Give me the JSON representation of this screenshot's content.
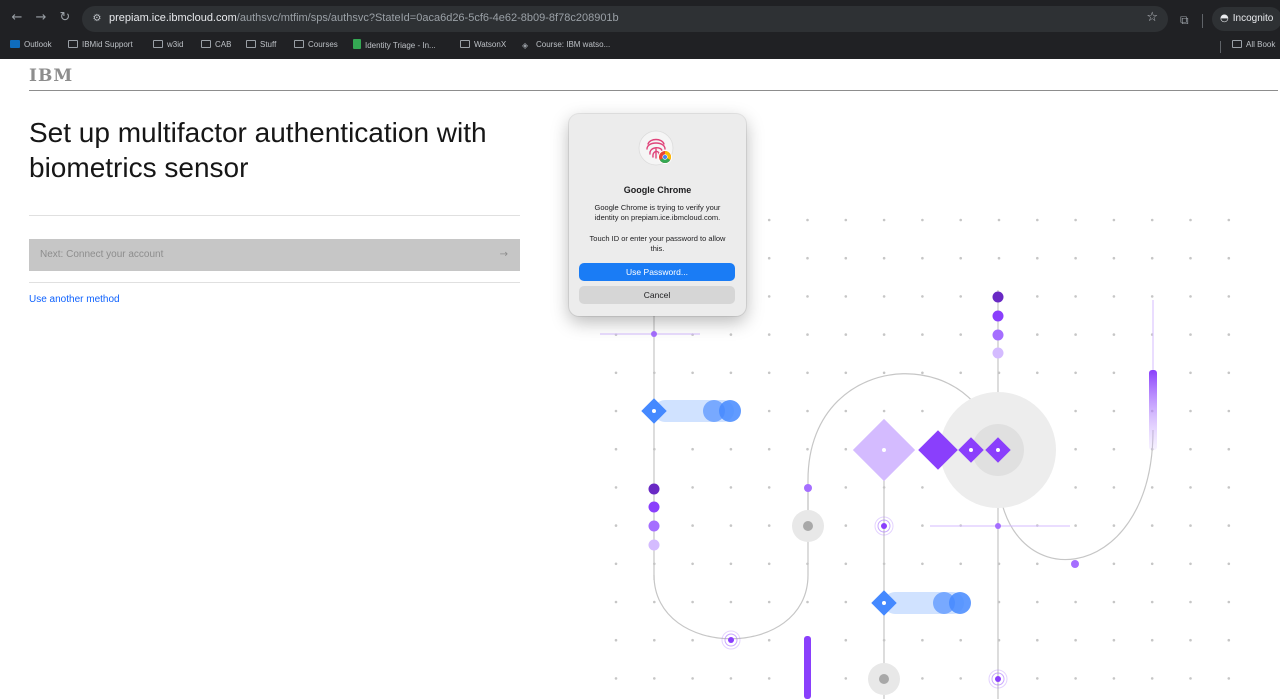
{
  "browser": {
    "url_host": "prepiam.ice.ibmcloud.com",
    "url_path": "/authsvc/mtfim/sps/authsvc?StateId=0aca6d26-5cf6-4e62-8b09-8f78c208901b",
    "incognito_label": "Incognito",
    "bookmarks": [
      {
        "label": "Outlook",
        "icon": "outlook-icon"
      },
      {
        "label": "IBMid Support",
        "icon": "folder-icon"
      },
      {
        "label": "w3id",
        "icon": "folder-icon"
      },
      {
        "label": "CAB",
        "icon": "folder-icon"
      },
      {
        "label": "Stuff",
        "icon": "folder-icon"
      },
      {
        "label": "Courses",
        "icon": "folder-icon"
      },
      {
        "label": "Identity Triage - In...",
        "icon": "sheet-icon"
      },
      {
        "label": "WatsonX",
        "icon": "folder-icon"
      },
      {
        "label": "Course: IBM watso...",
        "icon": "course-icon"
      }
    ],
    "all_bookmarks": "All Book"
  },
  "page": {
    "logo": "IBM",
    "title": "Set up multifactor authentication with biometrics sensor",
    "next_button": "Next: Connect your account",
    "alt_link": "Use another method"
  },
  "dialog": {
    "app_name": "Google Chrome",
    "message": "Google Chrome is trying to verify your identity on prepiam.ice.ibmcloud.com.",
    "instruction": "Touch ID or enter your password to allow this.",
    "primary_button": "Use Password...",
    "cancel_button": "Cancel"
  },
  "colors": {
    "chrome_bg": "#202124",
    "ibm_blue": "#0f62fe",
    "purple": "#8a3ffc",
    "light_purple": "#a56eff",
    "mac_blue": "#1a7cf5"
  }
}
